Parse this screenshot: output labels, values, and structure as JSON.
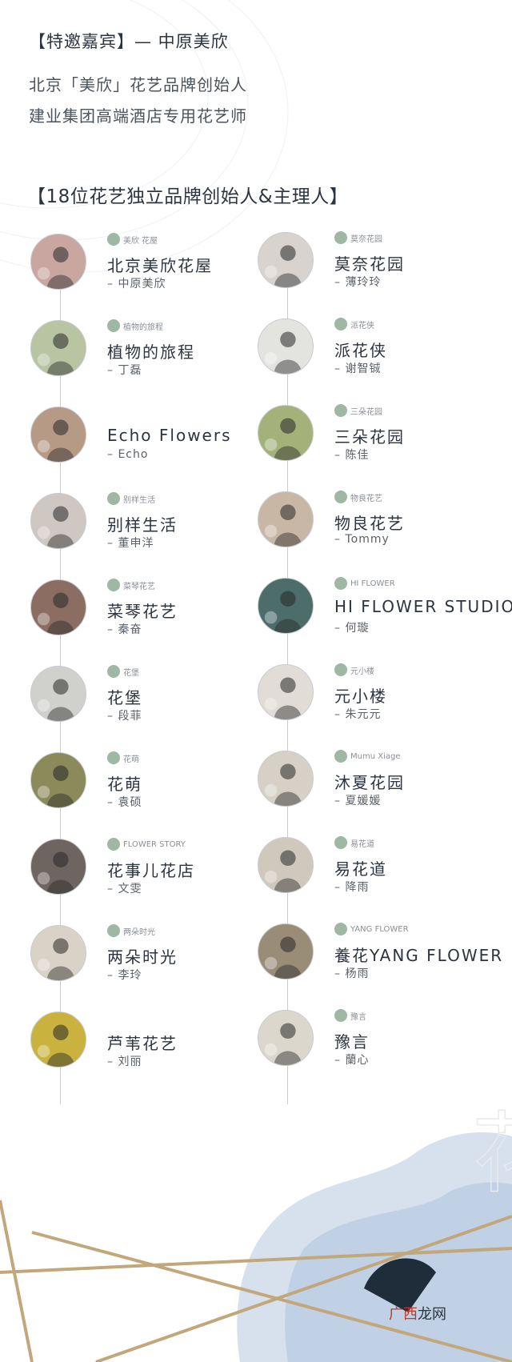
{
  "header": {
    "guest_line": "【特邀嘉宾】— 中原美欣",
    "desc1": "北京「美欣」花艺品牌创始人",
    "desc2": "建业集团高端酒店专用花艺师"
  },
  "section_title": "【18位花艺独立品牌创始人&主理人】",
  "left": [
    {
      "name": "北京美欣花屋",
      "person": "– 中原美欣",
      "logo": "美欣 花屋",
      "color": "#c9a7a0"
    },
    {
      "name": "植物的旅程",
      "person": "– 丁磊",
      "logo": "植物的旅程",
      "color": "#b9c4a2"
    },
    {
      "name": "Echo Flowers",
      "person": "– Echo",
      "logo": "",
      "color": "#b79a86"
    },
    {
      "name": "别样生活",
      "person": "– 董申洋",
      "logo": "别样生活",
      "color": "#cfc7c2"
    },
    {
      "name": "菜琴花艺",
      "person": "– 秦奋",
      "logo": "菜琴花艺",
      "color": "#8c6d62"
    },
    {
      "name": "花堡",
      "person": "– 段菲",
      "logo": "花堡",
      "color": "#d0d0cc"
    },
    {
      "name": "花萌",
      "person": "– 袁硕",
      "logo": "花萌",
      "color": "#8a8a5a"
    },
    {
      "name": "花事儿花店",
      "person": "– 文雯",
      "logo": "FLOWER STORY",
      "color": "#6e6560"
    },
    {
      "name": "两朵时光",
      "person": "– 李玲",
      "logo": "两朵时光",
      "color": "#d9d2c6"
    },
    {
      "name": "芦苇花艺",
      "person": "– 刘丽",
      "logo": "",
      "color": "#c9b23d"
    }
  ],
  "right": [
    {
      "name": "莫奈花园",
      "person": "– 薄玲玲",
      "logo": "莫奈花园",
      "color": "#d8d3cf"
    },
    {
      "name": "派花侠",
      "person": "– 谢智铖",
      "logo": "派花侠",
      "color": "#e3e3e0"
    },
    {
      "name": "三朵花园",
      "person": "– 陈佳",
      "logo": "三朵花园",
      "color": "#a4b27a"
    },
    {
      "name": "物良花艺",
      "person": "– Tommy",
      "logo": "物良花艺",
      "color": "#c9b7a5"
    },
    {
      "name": "HI FLOWER STUDIO",
      "person": "– 何璇",
      "logo": "HI FLOWER",
      "color": "#4c6d6a"
    },
    {
      "name": "元小楼",
      "person": "– 朱元元",
      "logo": "元小楼",
      "color": "#e1dcd6"
    },
    {
      "name": "沐夏花园",
      "person": "– 夏媛媛",
      "logo": "Mumu Xiage",
      "color": "#d6d0c6"
    },
    {
      "name": "易花道",
      "person": "– 降雨",
      "logo": "易花道",
      "color": "#cfc9bd"
    },
    {
      "name": "養花YANG FLOWER",
      "person": "– 杨雨",
      "logo": "YANG FLOWER",
      "color": "#9a8d78"
    },
    {
      "name": "豫言",
      "person": "– 蘭心",
      "logo": "豫言",
      "color": "#dbd7cd"
    }
  ],
  "watermark": {
    "red": "广西",
    "dark": "龙网"
  }
}
